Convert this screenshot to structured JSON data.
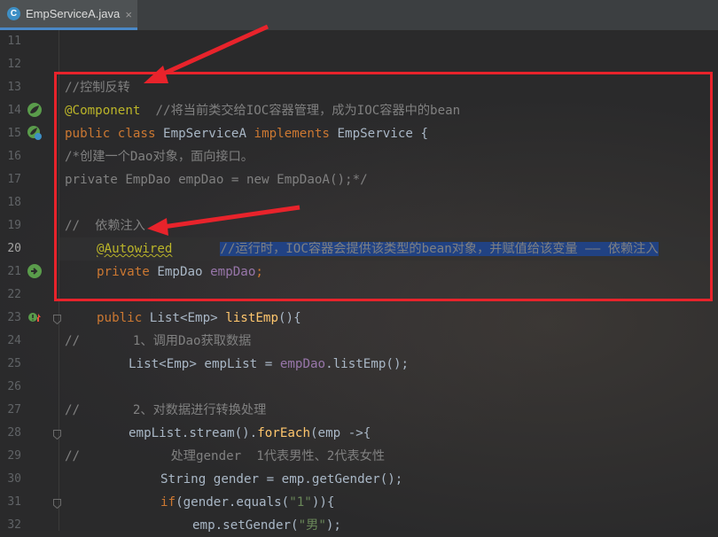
{
  "tab": {
    "icon": "C",
    "title": "EmpServiceA.java",
    "close": "×"
  },
  "gutter": {
    "line_numbers": [
      "11",
      "12",
      "13",
      "14",
      "15",
      "16",
      "17",
      "18",
      "19",
      "20",
      "21",
      "22",
      "23",
      "24",
      "25",
      "26",
      "27",
      "28",
      "29",
      "30",
      "31",
      "32"
    ],
    "active_line": "20"
  },
  "code": {
    "l13": "//控制反转",
    "l14_ann": "@Component",
    "l14_cm": "  //将当前类交给IOC容器管理，成为IOC容器中的bean",
    "l15_kw1": "public class ",
    "l15_cls": "EmpServiceA ",
    "l15_kw2": "implements ",
    "l15_rest": "EmpService {",
    "l16": "/*创建一个Dao对象，面向接口。",
    "l17": "private EmpDao empDao = new EmpDaoA();*/",
    "l19": "//  依赖注入",
    "l20_ann": "@Autowired",
    "l20_cm": "//运行时，IOC容器会提供该类型的bean对象，并赋值给该变量 —— 依赖注入",
    "l21_kw": "private ",
    "l21_type": "EmpDao ",
    "l21_fld": "empDao",
    "l21_end": ";",
    "l23_kw": "public ",
    "l23_type": "List<Emp> ",
    "l23_mth": "listEmp",
    "l23_end": "(){",
    "l24": "//       1、调用Dao获取数据",
    "l25_a": "List<Emp> empList = ",
    "l25_fld": "empDao",
    "l25_b": ".listEmp();",
    "l27": "//       2、对数据进行转换处理",
    "l28_a": "empList.stream().",
    "l28_m": "forEach",
    "l28_b": "(emp ->{",
    "l29_a": "//            处理gender  1代表男性、2代表女性",
    "l30": "String gender = emp.getGender();",
    "l31_kw": "if",
    "l31_a": "(gender.equals(",
    "l31_str": "\"1\"",
    "l31_b": ")){",
    "l32_a": "emp.setGender(",
    "l32_str": "\"男\"",
    "l32_b": ");"
  }
}
